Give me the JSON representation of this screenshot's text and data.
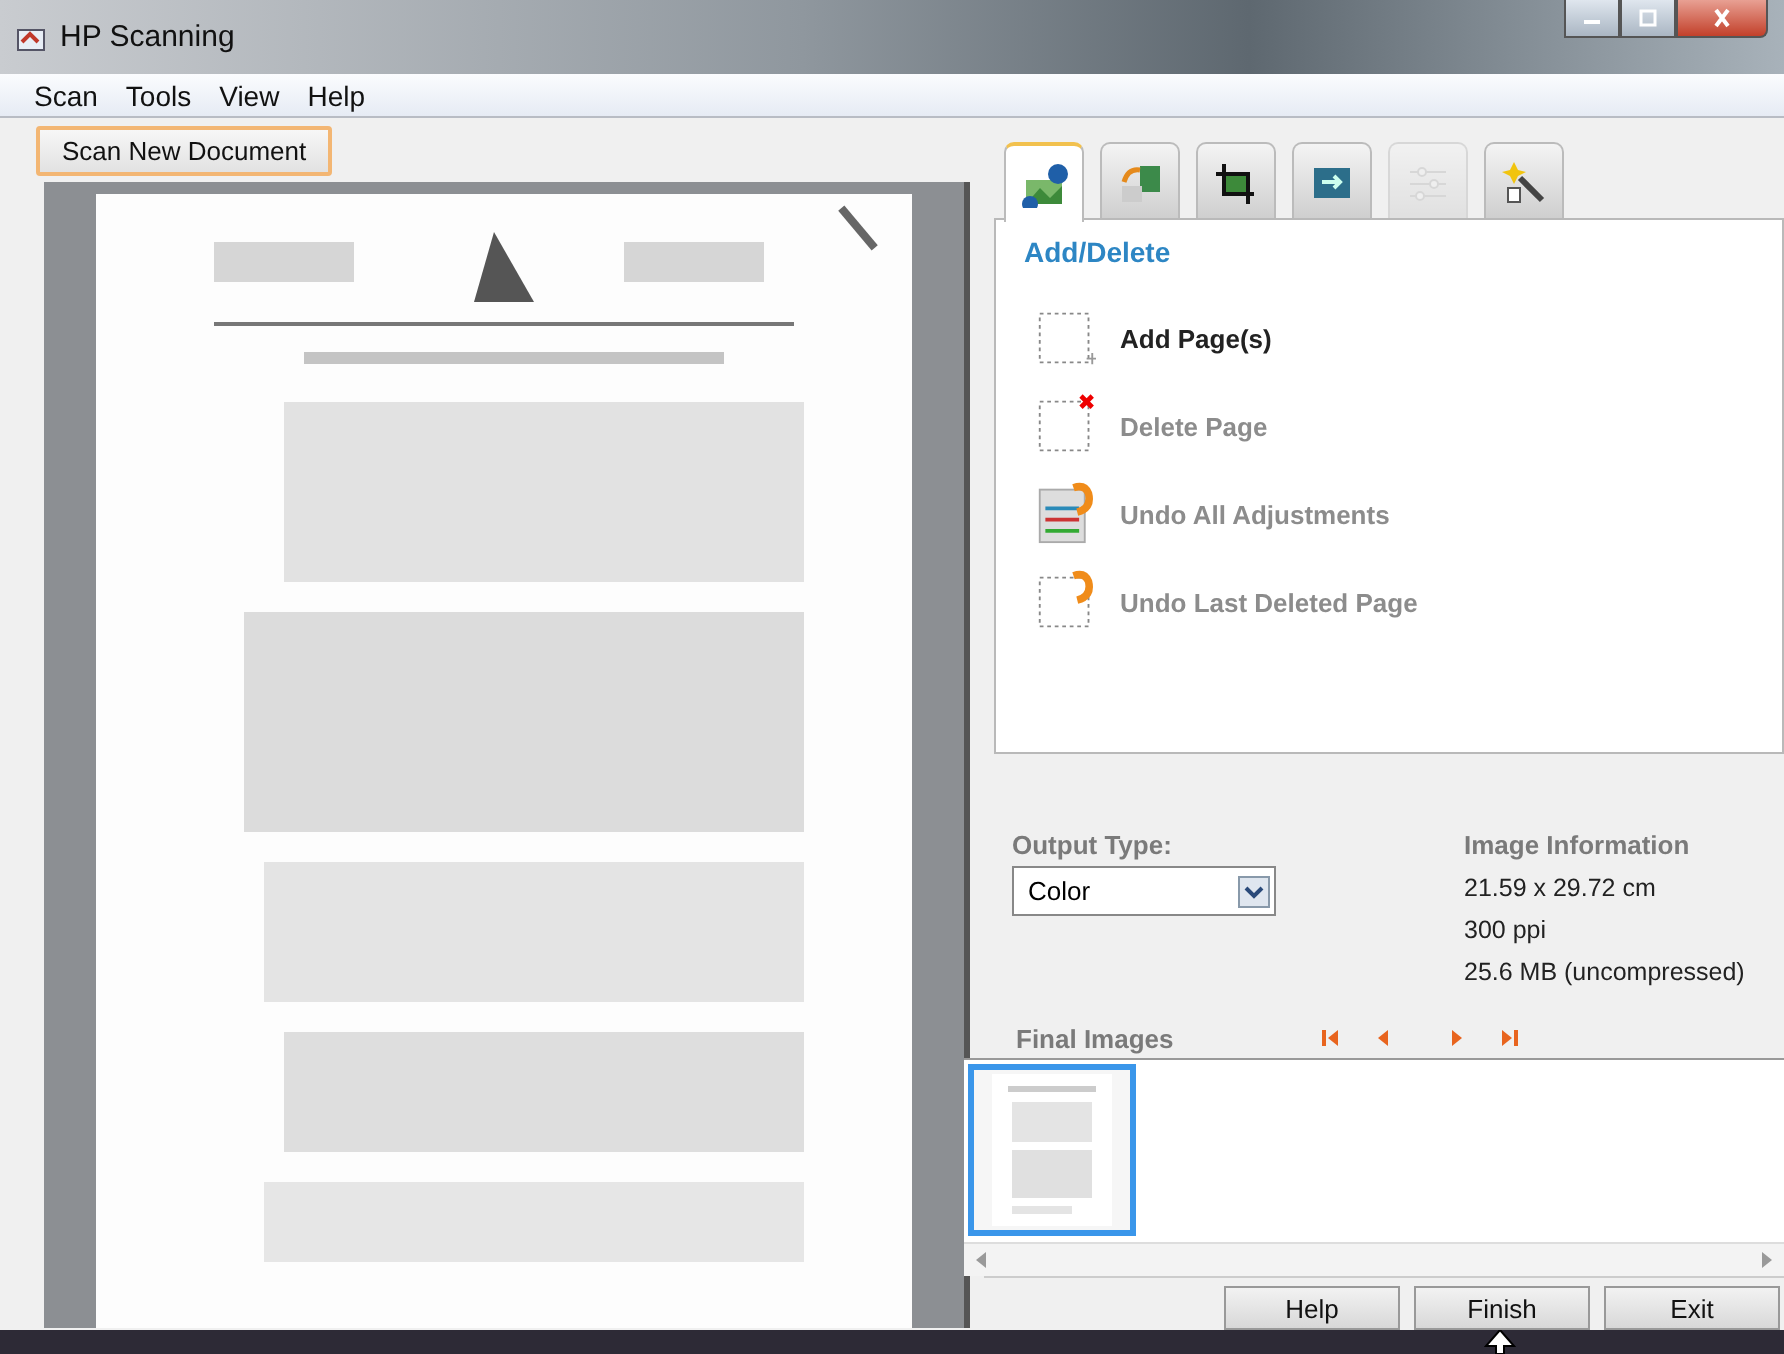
{
  "window": {
    "title": "HP Scanning"
  },
  "menu": [
    "Scan",
    "Tools",
    "View",
    "Help"
  ],
  "scan_button": {
    "label": "Scan New Document"
  },
  "preview": {
    "kind": "picture"
  },
  "tabs": [
    {
      "kind": "add-delete",
      "selected": true,
      "disabled": false
    },
    {
      "kind": "rotate",
      "selected": false,
      "disabled": false
    },
    {
      "kind": "crop",
      "selected": false,
      "disabled": false
    },
    {
      "kind": "swap",
      "selected": false,
      "disabled": false
    },
    {
      "kind": "adjust",
      "selected": false,
      "disabled": true
    },
    {
      "kind": "wand",
      "selected": false,
      "disabled": false
    }
  ],
  "panel": {
    "title": "Add/Delete",
    "actions": [
      {
        "kind": "add",
        "label": "Add Page(s)",
        "disabled": false
      },
      {
        "kind": "delete",
        "label": "Delete Page",
        "disabled": true
      },
      {
        "kind": "undo-adjust",
        "label": "Undo All Adjustments",
        "disabled": true
      },
      {
        "kind": "undo-delete",
        "label": "Undo Last Deleted Page",
        "disabled": true
      }
    ]
  },
  "output_type": {
    "label": "Output Type:",
    "value": "Color"
  },
  "image_info": {
    "title": "Image Information",
    "lines": [
      "21.59 x 29.72 cm",
      "300 ppi",
      "25.6 MB (uncompressed)"
    ]
  },
  "final_images": {
    "label": "Final Images",
    "nav": [
      {
        "kind": "first"
      },
      {
        "kind": "prev"
      },
      {
        "kind": "next"
      },
      {
        "kind": "last"
      }
    ],
    "thumbnails": [
      {
        "selected": true
      }
    ]
  },
  "buttons": [
    "Help",
    "Finish",
    "Exit"
  ]
}
